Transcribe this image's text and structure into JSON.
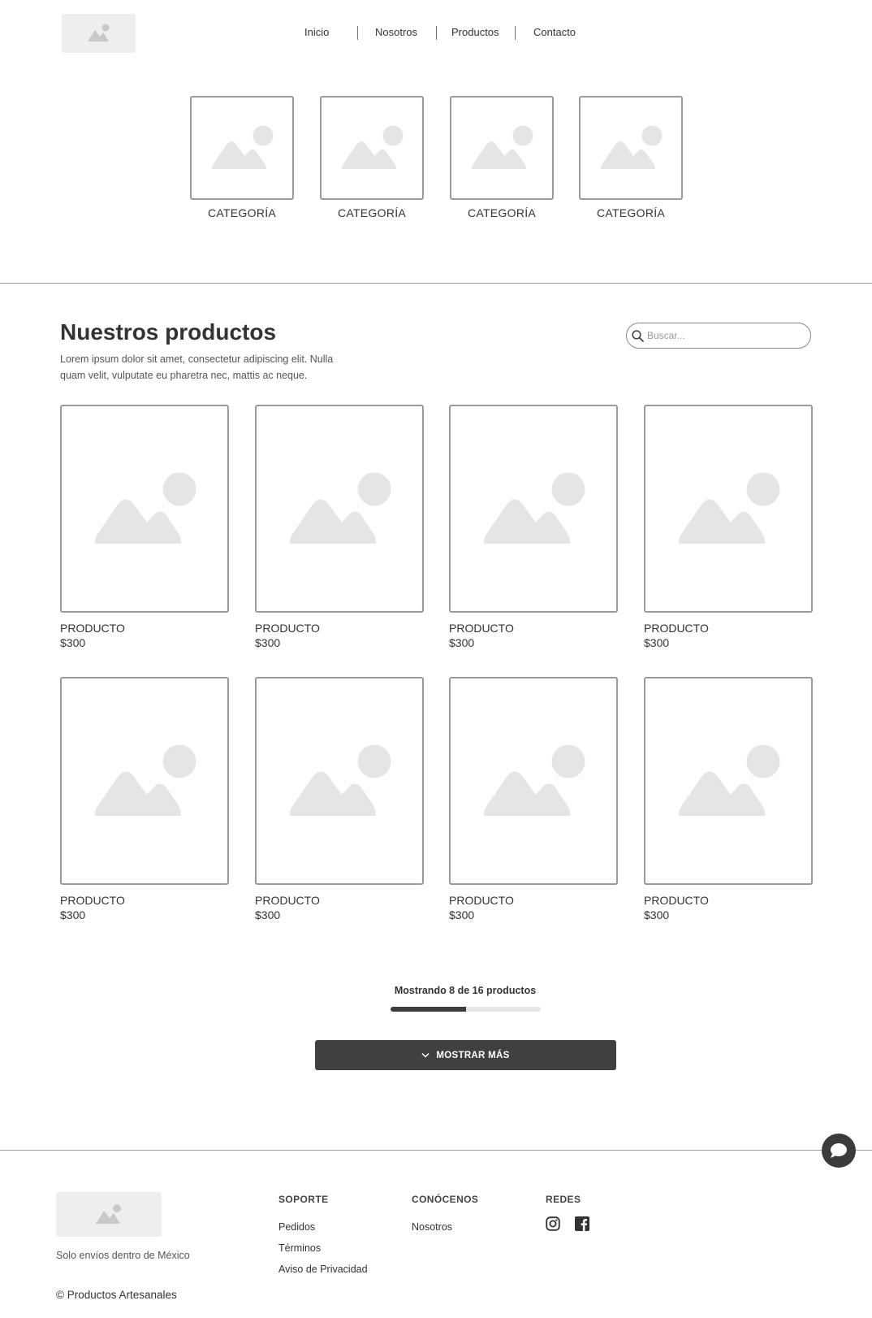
{
  "header": {
    "logo_icon": "image-placeholder-icon",
    "nav": [
      "Inicio",
      "Nosotros",
      "Productos",
      "Contacto"
    ]
  },
  "categories": [
    {
      "label": "CATEGORÍA"
    },
    {
      "label": "CATEGORÍA"
    },
    {
      "label": "CATEGORÍA"
    },
    {
      "label": "CATEGORÍA"
    }
  ],
  "products_section": {
    "title": "Nuestros productos",
    "description": "Lorem ipsum dolor sit amet, consectetur adipiscing elit. Nulla quam velit, vulputate eu pharetra nec, mattis ac neque.",
    "search_placeholder": "Buscar...",
    "products": [
      {
        "name": "PRODUCTO",
        "price": "$300"
      },
      {
        "name": "PRODUCTO",
        "price": "$300"
      },
      {
        "name": "PRODUCTO",
        "price": "$300"
      },
      {
        "name": "PRODUCTO",
        "price": "$300"
      },
      {
        "name": "PRODUCTO",
        "price": "$300"
      },
      {
        "name": "PRODUCTO",
        "price": "$300"
      },
      {
        "name": "PRODUCTO",
        "price": "$300"
      },
      {
        "name": "PRODUCTO",
        "price": "$300"
      }
    ],
    "counter_text": "Mostrando 8 de 16 productos",
    "shown": 8,
    "total": 16,
    "more_label": "MOSTRAR MÁS"
  },
  "footer": {
    "shipping_note": "Solo envíos dentro de México",
    "copyright": "© Productos Artesanales",
    "support": {
      "heading": "SOPORTE",
      "links": [
        "Pedidos",
        "Términos",
        "Aviso de Privacidad"
      ]
    },
    "about": {
      "heading": "CONÓCENOS",
      "links": [
        "Nosotros"
      ]
    },
    "social": {
      "heading": "REDES",
      "icons": [
        "instagram-icon",
        "facebook-icon"
      ]
    }
  },
  "colors": {
    "placeholder_gray": "#e5e5e5",
    "dark_button": "#404040",
    "border_gray": "#9a9a9a"
  }
}
